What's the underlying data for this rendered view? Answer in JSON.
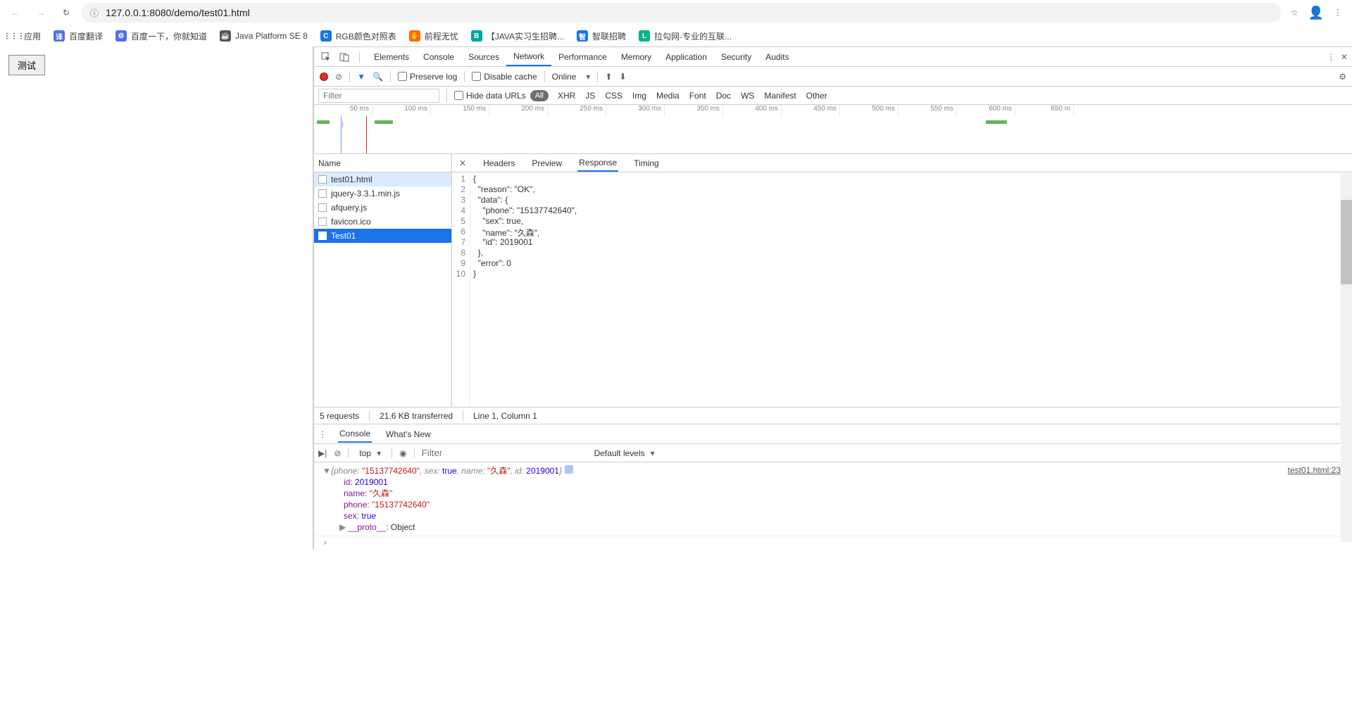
{
  "browser": {
    "url": "127.0.0.1:8080/demo/test01.html",
    "bookmarks": [
      {
        "label": "应用",
        "bg": "#fff",
        "fg": "#333",
        "glyph": "⋮⋮⋮"
      },
      {
        "label": "百度翻译",
        "bg": "#4e6ef2",
        "glyph": "译"
      },
      {
        "label": "百度一下，你就知道",
        "bg": "#4e6ef2",
        "glyph": "⚙"
      },
      {
        "label": "Java Platform SE 8",
        "bg": "#555",
        "glyph": "☕"
      },
      {
        "label": "RGB颜色对照表",
        "bg": "#1a73e8",
        "glyph": "C"
      },
      {
        "label": "前程无忧",
        "bg": "#ff6a00",
        "glyph": "✋"
      },
      {
        "label": "【JAVA实习生招聘...",
        "bg": "#00a6a0",
        "glyph": "B"
      },
      {
        "label": "智联招聘",
        "bg": "#1a73e8",
        "glyph": "智"
      },
      {
        "label": "拉勾网-专业的互联...",
        "bg": "#00b38a",
        "glyph": "L"
      }
    ]
  },
  "page": {
    "test_button": "测试"
  },
  "devtools": {
    "tabs": [
      "Elements",
      "Console",
      "Sources",
      "Network",
      "Performance",
      "Memory",
      "Application",
      "Security",
      "Audits"
    ],
    "active_tab": "Network",
    "net_toolbar": {
      "preserve_log": "Preserve log",
      "disable_cache": "Disable cache",
      "online": "Online"
    },
    "filter": {
      "placeholder": "Filter",
      "hide_urls": "Hide data URLs",
      "all": "All",
      "cats": [
        "XHR",
        "JS",
        "CSS",
        "Img",
        "Media",
        "Font",
        "Doc",
        "WS",
        "Manifest",
        "Other"
      ]
    },
    "timeline_ticks": [
      "50 ms",
      "100 ms",
      "150 ms",
      "200 ms",
      "250 ms",
      "300 ms",
      "350 ms",
      "400 ms",
      "450 ms",
      "500 ms",
      "550 ms",
      "600 ms",
      "650 m"
    ],
    "requests": {
      "header": "Name",
      "items": [
        {
          "name": "test01.html",
          "hl": true
        },
        {
          "name": "jquery-3.3.1.min.js"
        },
        {
          "name": "afquery.js"
        },
        {
          "name": "favicon.ico"
        },
        {
          "name": "Test01",
          "sel": true,
          "dark": true
        }
      ]
    },
    "resp_tabs": [
      "Headers",
      "Preview",
      "Response",
      "Timing"
    ],
    "resp_active": "Response",
    "response_lines": [
      "{",
      "  \"reason\": \"OK\",",
      "  \"data\": {",
      "    \"phone\": \"15137742640\",",
      "    \"sex\": true,",
      "    \"name\": \"久森\",",
      "    \"id\": 2019001",
      "  },",
      "  \"error\": 0",
      "}"
    ],
    "status": {
      "requests": "5 requests",
      "transferred": "21.6 KB transferred",
      "cursor": "Line 1, Column 1"
    },
    "drawer_tabs": [
      "Console",
      "What's New"
    ],
    "drawer_active": "Console",
    "drawer_toolbar": {
      "context": "top",
      "filter_placeholder": "Filter",
      "levels": "Default levels"
    },
    "console": {
      "summary_phone": "\"15137742640\"",
      "summary_sex": "true",
      "summary_name": "\"久森\"",
      "summary_id": "2019001",
      "id_lbl": "id:",
      "id_val": "2019001",
      "name_lbl": "name:",
      "name_val": "\"久森\"",
      "phone_lbl": "phone:",
      "phone_val": "\"15137742640\"",
      "sex_lbl": "sex:",
      "sex_val": "true",
      "proto_lbl": "__proto__:",
      "proto_val": "Object",
      "src_link": "test01.html:23"
    }
  }
}
